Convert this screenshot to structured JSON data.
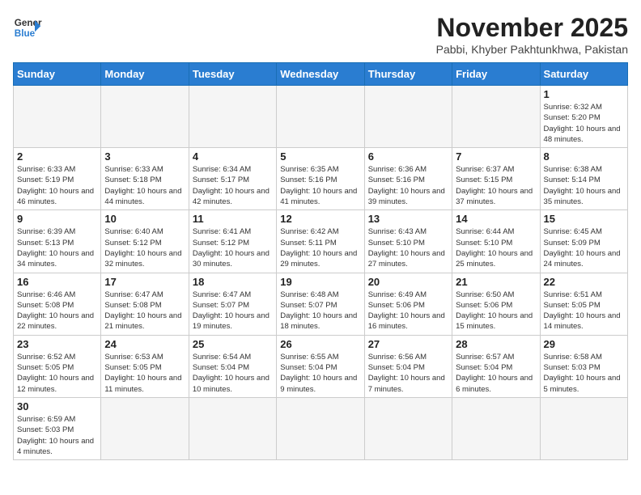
{
  "header": {
    "logo_line1": "General",
    "logo_line2": "Blue",
    "month_title": "November 2025",
    "location": "Pabbi, Khyber Pakhtunkhwa, Pakistan"
  },
  "weekdays": [
    "Sunday",
    "Monday",
    "Tuesday",
    "Wednesday",
    "Thursday",
    "Friday",
    "Saturday"
  ],
  "weeks": [
    [
      {
        "day": "",
        "info": ""
      },
      {
        "day": "",
        "info": ""
      },
      {
        "day": "",
        "info": ""
      },
      {
        "day": "",
        "info": ""
      },
      {
        "day": "",
        "info": ""
      },
      {
        "day": "",
        "info": ""
      },
      {
        "day": "1",
        "info": "Sunrise: 6:32 AM\nSunset: 5:20 PM\nDaylight: 10 hours and 48 minutes."
      }
    ],
    [
      {
        "day": "2",
        "info": "Sunrise: 6:33 AM\nSunset: 5:19 PM\nDaylight: 10 hours and 46 minutes."
      },
      {
        "day": "3",
        "info": "Sunrise: 6:33 AM\nSunset: 5:18 PM\nDaylight: 10 hours and 44 minutes."
      },
      {
        "day": "4",
        "info": "Sunrise: 6:34 AM\nSunset: 5:17 PM\nDaylight: 10 hours and 42 minutes."
      },
      {
        "day": "5",
        "info": "Sunrise: 6:35 AM\nSunset: 5:16 PM\nDaylight: 10 hours and 41 minutes."
      },
      {
        "day": "6",
        "info": "Sunrise: 6:36 AM\nSunset: 5:16 PM\nDaylight: 10 hours and 39 minutes."
      },
      {
        "day": "7",
        "info": "Sunrise: 6:37 AM\nSunset: 5:15 PM\nDaylight: 10 hours and 37 minutes."
      },
      {
        "day": "8",
        "info": "Sunrise: 6:38 AM\nSunset: 5:14 PM\nDaylight: 10 hours and 35 minutes."
      }
    ],
    [
      {
        "day": "9",
        "info": "Sunrise: 6:39 AM\nSunset: 5:13 PM\nDaylight: 10 hours and 34 minutes."
      },
      {
        "day": "10",
        "info": "Sunrise: 6:40 AM\nSunset: 5:12 PM\nDaylight: 10 hours and 32 minutes."
      },
      {
        "day": "11",
        "info": "Sunrise: 6:41 AM\nSunset: 5:12 PM\nDaylight: 10 hours and 30 minutes."
      },
      {
        "day": "12",
        "info": "Sunrise: 6:42 AM\nSunset: 5:11 PM\nDaylight: 10 hours and 29 minutes."
      },
      {
        "day": "13",
        "info": "Sunrise: 6:43 AM\nSunset: 5:10 PM\nDaylight: 10 hours and 27 minutes."
      },
      {
        "day": "14",
        "info": "Sunrise: 6:44 AM\nSunset: 5:10 PM\nDaylight: 10 hours and 25 minutes."
      },
      {
        "day": "15",
        "info": "Sunrise: 6:45 AM\nSunset: 5:09 PM\nDaylight: 10 hours and 24 minutes."
      }
    ],
    [
      {
        "day": "16",
        "info": "Sunrise: 6:46 AM\nSunset: 5:08 PM\nDaylight: 10 hours and 22 minutes."
      },
      {
        "day": "17",
        "info": "Sunrise: 6:47 AM\nSunset: 5:08 PM\nDaylight: 10 hours and 21 minutes."
      },
      {
        "day": "18",
        "info": "Sunrise: 6:47 AM\nSunset: 5:07 PM\nDaylight: 10 hours and 19 minutes."
      },
      {
        "day": "19",
        "info": "Sunrise: 6:48 AM\nSunset: 5:07 PM\nDaylight: 10 hours and 18 minutes."
      },
      {
        "day": "20",
        "info": "Sunrise: 6:49 AM\nSunset: 5:06 PM\nDaylight: 10 hours and 16 minutes."
      },
      {
        "day": "21",
        "info": "Sunrise: 6:50 AM\nSunset: 5:06 PM\nDaylight: 10 hours and 15 minutes."
      },
      {
        "day": "22",
        "info": "Sunrise: 6:51 AM\nSunset: 5:05 PM\nDaylight: 10 hours and 14 minutes."
      }
    ],
    [
      {
        "day": "23",
        "info": "Sunrise: 6:52 AM\nSunset: 5:05 PM\nDaylight: 10 hours and 12 minutes."
      },
      {
        "day": "24",
        "info": "Sunrise: 6:53 AM\nSunset: 5:05 PM\nDaylight: 10 hours and 11 minutes."
      },
      {
        "day": "25",
        "info": "Sunrise: 6:54 AM\nSunset: 5:04 PM\nDaylight: 10 hours and 10 minutes."
      },
      {
        "day": "26",
        "info": "Sunrise: 6:55 AM\nSunset: 5:04 PM\nDaylight: 10 hours and 9 minutes."
      },
      {
        "day": "27",
        "info": "Sunrise: 6:56 AM\nSunset: 5:04 PM\nDaylight: 10 hours and 7 minutes."
      },
      {
        "day": "28",
        "info": "Sunrise: 6:57 AM\nSunset: 5:04 PM\nDaylight: 10 hours and 6 minutes."
      },
      {
        "day": "29",
        "info": "Sunrise: 6:58 AM\nSunset: 5:03 PM\nDaylight: 10 hours and 5 minutes."
      }
    ],
    [
      {
        "day": "30",
        "info": "Sunrise: 6:59 AM\nSunset: 5:03 PM\nDaylight: 10 hours and 4 minutes."
      },
      {
        "day": "",
        "info": ""
      },
      {
        "day": "",
        "info": ""
      },
      {
        "day": "",
        "info": ""
      },
      {
        "day": "",
        "info": ""
      },
      {
        "day": "",
        "info": ""
      },
      {
        "day": "",
        "info": ""
      }
    ]
  ]
}
